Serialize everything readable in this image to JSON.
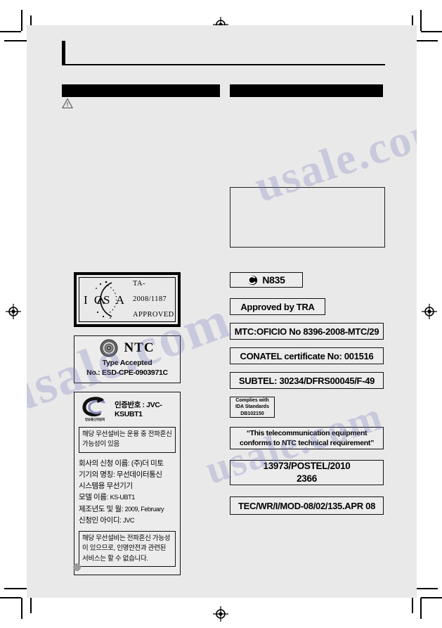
{
  "document": {
    "sheet_background": "#e9e9e9",
    "paper_background": "#ffffff",
    "redaction_color": "#000000"
  },
  "header": {
    "title_redacted": true,
    "bar_left_label": "",
    "bar_right_label": "",
    "warning_icon": "warning-triangle-icon"
  },
  "empty_frame": {
    "content": ""
  },
  "left_column": {
    "icasa": {
      "logo_name": "icasa-logo",
      "wordmark": "I C A S A",
      "line1": "TA-2008/1187",
      "line2": "APPROVED"
    },
    "ntc": {
      "seal_name": "ntc-seal-icon",
      "title": "NTC",
      "subtitle": "Type Accepted",
      "number": "No.: ESD-CPE-0903971C"
    },
    "kcc": {
      "logo_name": "kcc-logo",
      "logo_caption": "방송통신위원회",
      "cert_number": "인증반호 : JVC-KSUBT1",
      "notice": "해당 무선설비는 운용 중 전파혼신 가능성이 있음",
      "fields": [
        "회사의 신청 이름: (주)더 미토",
        "기기의 명칭: 무선데이터통신",
        "시스템용 무선기기",
        "모델 이름: KS-UBT1",
        "제조년도 및 월: 2009, February",
        "신청인 아이디: JVC"
      ],
      "model_label": "모델 이름:",
      "model_value": "KS-UBT1",
      "mfg_label": "제조년도 및 월:",
      "mfg_value": "2009, February",
      "applicant_label": "신청인 아이디:",
      "applicant_value": "JVC",
      "warning": "해당 무선설비는 전파혼신 가능성이 있으므로, 인명안전과 관련된 서비스는 할 수 없습니다."
    }
  },
  "right_column": {
    "badges": [
      {
        "id": "n835",
        "icon": "c-tick-icon",
        "text": "N835"
      },
      {
        "id": "tra",
        "text": "Approved by TRA"
      },
      {
        "id": "mtc",
        "text": "MTC:OFICIO No 8396-2008-MTC/29"
      },
      {
        "id": "conatel",
        "text": "CONATEL certificate No: 001516"
      },
      {
        "id": "subtel",
        "text": "SUBTEL: 30234/DFRS00045/F-49"
      },
      {
        "id": "ida",
        "line1": "Complies with",
        "line2": "IDA Standards",
        "line3": "DB102150"
      },
      {
        "id": "ntcreq",
        "text": "“This telecommunication equipment conforms to NTC technical requirement”"
      },
      {
        "id": "postel",
        "line1": "13973/POSTEL/2010",
        "line2": "2366"
      },
      {
        "id": "tec",
        "text": "TEC/WR/I/MOD-08/02/135.APR 08"
      }
    ]
  },
  "footer": {
    "page_marker": ""
  },
  "print_marks": {
    "registration_target_name": "registration-target-icon",
    "crop_mark_name": "crop-mark"
  },
  "watermark": {
    "text": "usale.com"
  }
}
